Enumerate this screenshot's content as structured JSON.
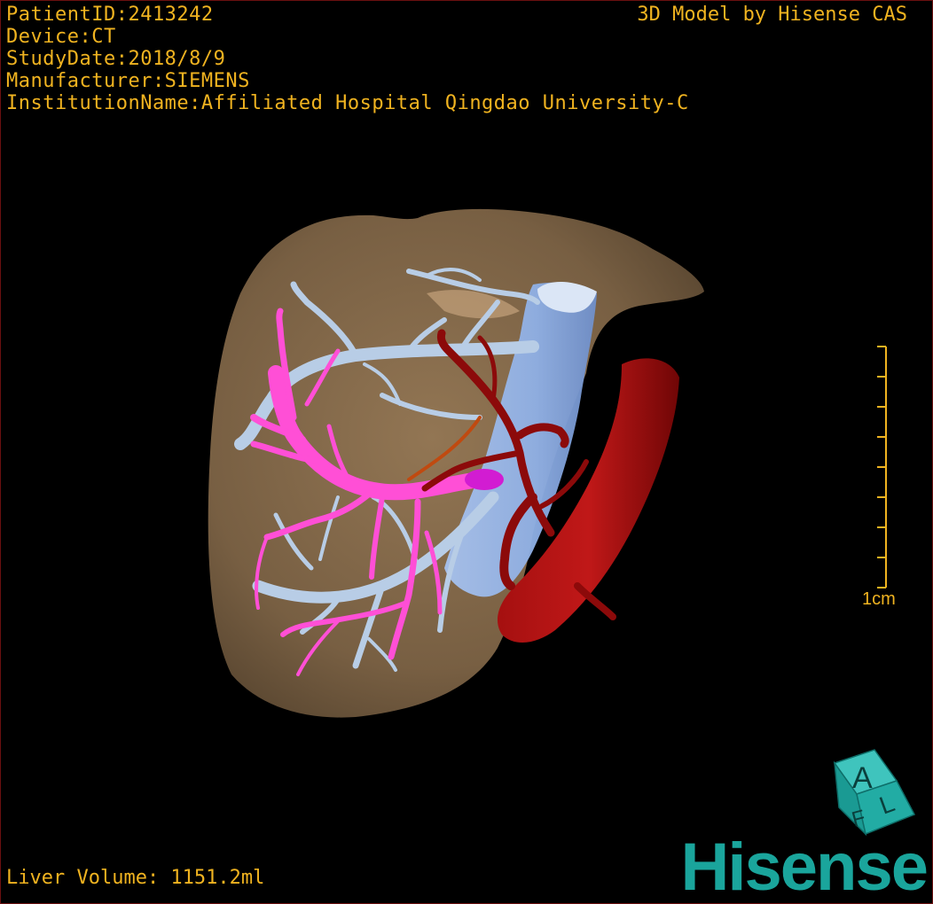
{
  "header": {
    "patient_id": "PatientID:2413242",
    "device": "Device:CT",
    "study_date": "StudyDate:2018/8/9",
    "manufacturer": "Manufacturer:SIEMENS",
    "institution": "InstitutionName:Affiliated Hospital Qingdao University-C"
  },
  "model_credit": "3D Model by Hisense CAS",
  "scale_bar": {
    "label": "1cm"
  },
  "footer": {
    "liver_volume": "Liver Volume: 1151.2ml"
  },
  "orientation_cube": {
    "faces": [
      "A",
      "F",
      "L"
    ]
  },
  "brand": {
    "name": "Hisense"
  },
  "colors": {
    "text": "#f0b320",
    "liver": "#8c7150",
    "hepatic_vein": "#b8cde6",
    "portal_vein": "#ff4fd6",
    "artery": "#8c0a0a",
    "ivc": "#8fb0e6",
    "brand": "#1aa59c"
  }
}
